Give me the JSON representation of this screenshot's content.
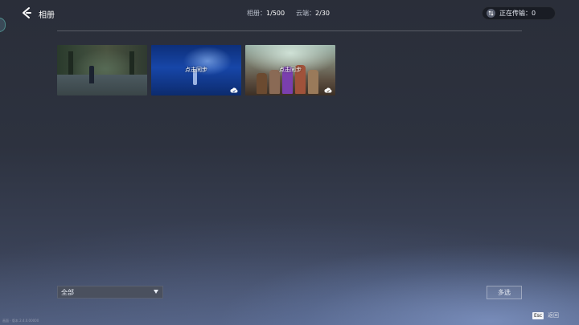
{
  "header": {
    "title": "相册",
    "album_label": "相册：",
    "album_value": "1/500",
    "cloud_label": "云端：",
    "cloud_value": "2/30",
    "transfer_label": "正在传输：",
    "transfer_value": "0"
  },
  "gallery": {
    "items": [
      {
        "label": "",
        "has_cloud_badge": false
      },
      {
        "label": "点击同步",
        "has_cloud_badge": true
      },
      {
        "label": "点击同步",
        "has_cloud_badge": true
      }
    ]
  },
  "footer": {
    "filter_value": "全部",
    "multi_select_label": "多选",
    "esc_key_label": "Esc",
    "esc_action_label": "返回",
    "corner_text": "画面 · 版本 2.4.0.00000"
  },
  "icons": {
    "back": "chevron-left-icon",
    "transfer": "transfer-arrows-icon",
    "cloud": "cloud-check-icon",
    "dropdown": "triangle-down-icon"
  }
}
